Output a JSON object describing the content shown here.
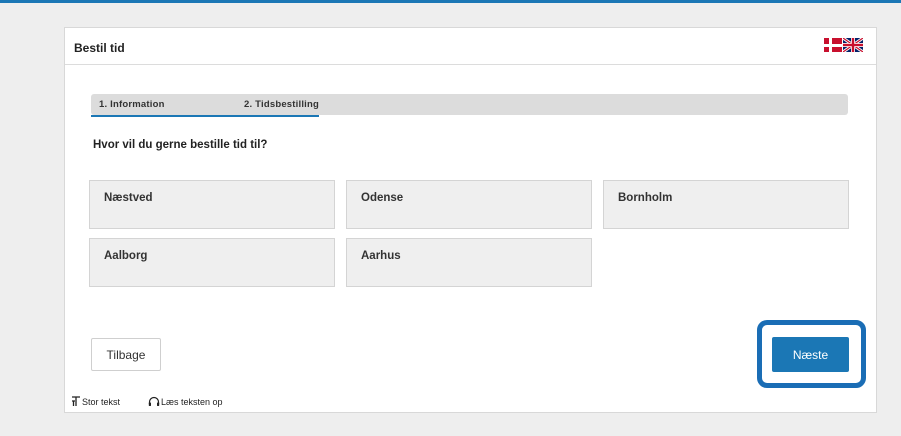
{
  "header": {
    "title": "Bestil tid",
    "languages": [
      {
        "code": "da",
        "icon": "danish-flag-icon"
      },
      {
        "code": "en",
        "icon": "uk-flag-icon"
      }
    ]
  },
  "steps": [
    {
      "label": "1. Information"
    },
    {
      "label": "2. Tidsbestilling"
    }
  ],
  "question": "Hvor vil du gerne bestille tid til?",
  "locations": [
    "Næstved",
    "Odense",
    "Bornholm",
    "Aalborg",
    "Aarhus"
  ],
  "buttons": {
    "back": "Tilbage",
    "next": "Næste"
  },
  "accessibility": {
    "large_text": "Stor tekst",
    "read_aloud": "Læs teksten op"
  },
  "colors": {
    "accent": "#1b77b5",
    "highlight": "#1a6db5"
  }
}
